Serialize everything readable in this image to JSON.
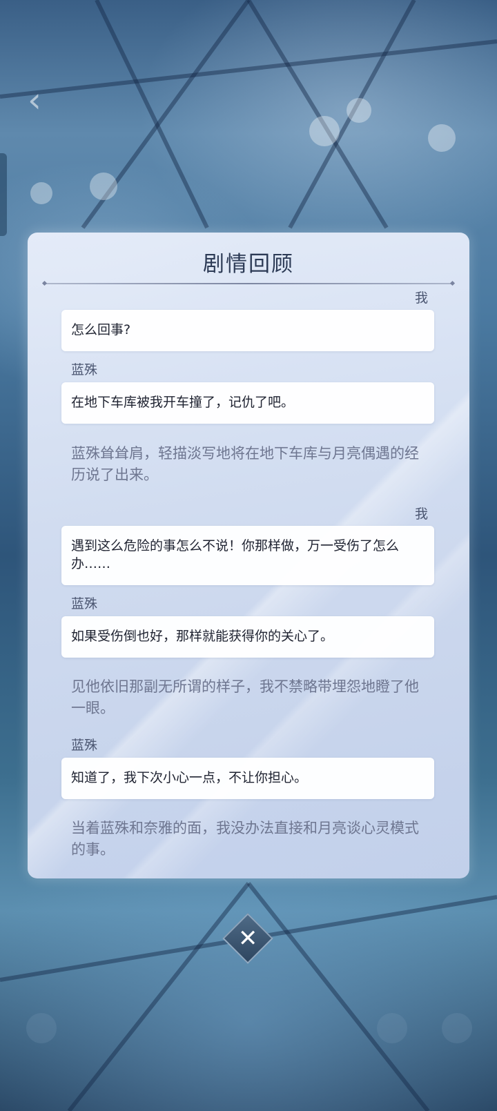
{
  "title": "剧情回顾",
  "entries": [
    {
      "type": "dialogue",
      "speaker": "我",
      "side": "right",
      "text": "怎么回事?"
    },
    {
      "type": "dialogue",
      "speaker": "蓝殊",
      "side": "left",
      "text": "在地下车库被我开车撞了，记仇了吧。"
    },
    {
      "type": "narration",
      "text": "蓝殊耸耸肩，轻描淡写地将在地下车库与月亮偶遇的经历说了出来。"
    },
    {
      "type": "dialogue",
      "speaker": "我",
      "side": "right",
      "text": "遇到这么危险的事怎么不说！你那样做，万一受伤了怎么办……"
    },
    {
      "type": "dialogue",
      "speaker": "蓝殊",
      "side": "left",
      "text": "如果受伤倒也好，那样就能获得你的关心了。"
    },
    {
      "type": "narration",
      "text": "见他依旧那副无所谓的样子，我不禁略带埋怨地瞪了他一眼。"
    },
    {
      "type": "dialogue",
      "speaker": "蓝殊",
      "side": "left",
      "text": "知道了，我下次小心一点，不让你担心。"
    },
    {
      "type": "narration",
      "text": "当着蓝殊和奈雅的面，我没办法直接和月亮谈心灵模式的事。"
    }
  ],
  "close_label": "✕",
  "back_label": "‹"
}
